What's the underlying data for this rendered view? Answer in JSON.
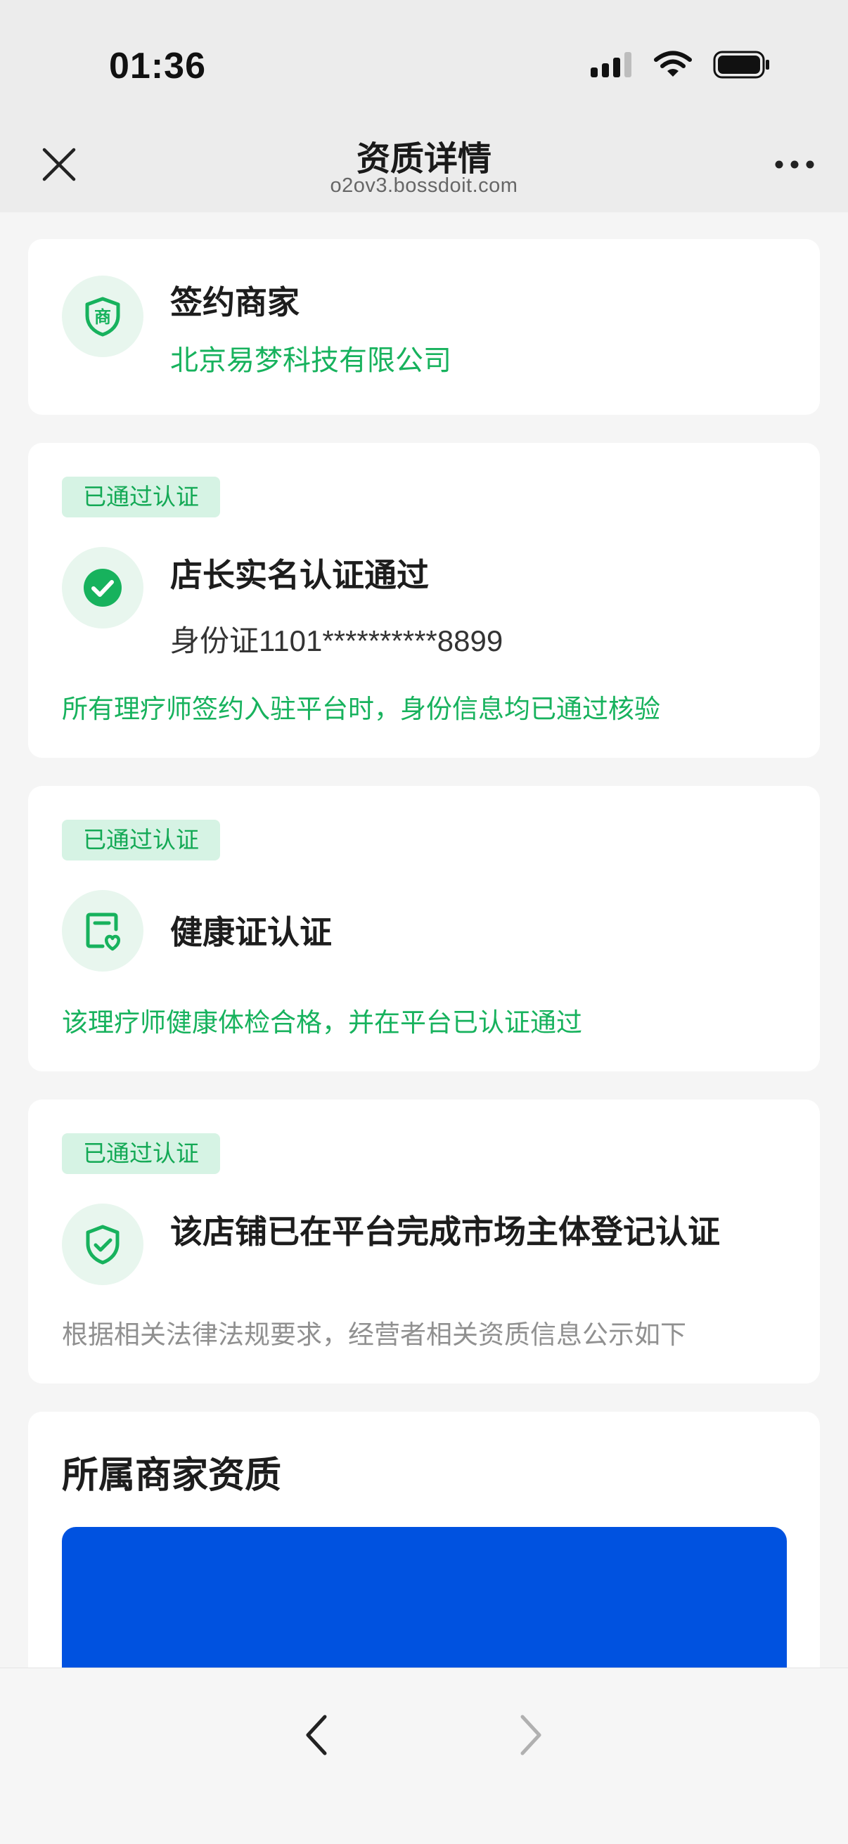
{
  "status_bar": {
    "time": "01:36"
  },
  "header": {
    "title": "资质详情",
    "subtitle": "o2ov3.bossdoit.com"
  },
  "merchant_card": {
    "title": "签约商家",
    "name": "北京易梦科技有限公司"
  },
  "cards": [
    {
      "badge": "已通过认证",
      "title": "店长实名认证通过",
      "id_text": "身份证1101**********8899",
      "note": "所有理疗师签约入驻平台时，身份信息均已通过核验"
    },
    {
      "badge": "已通过认证",
      "title": "健康证认证",
      "note": "该理疗师健康体检合格，并在平台已认证通过"
    },
    {
      "badge": "已通过认证",
      "title": "该店铺已在平台完成市场主体登记认证",
      "note": "根据相关法律法规要求，经营者相关资质信息公示如下"
    }
  ],
  "qualification_section": {
    "title": "所属商家资质"
  },
  "colors": {
    "accent_green": "#17b25d",
    "badge_bg": "#d6f3e4",
    "blue_block": "#0052e0"
  }
}
